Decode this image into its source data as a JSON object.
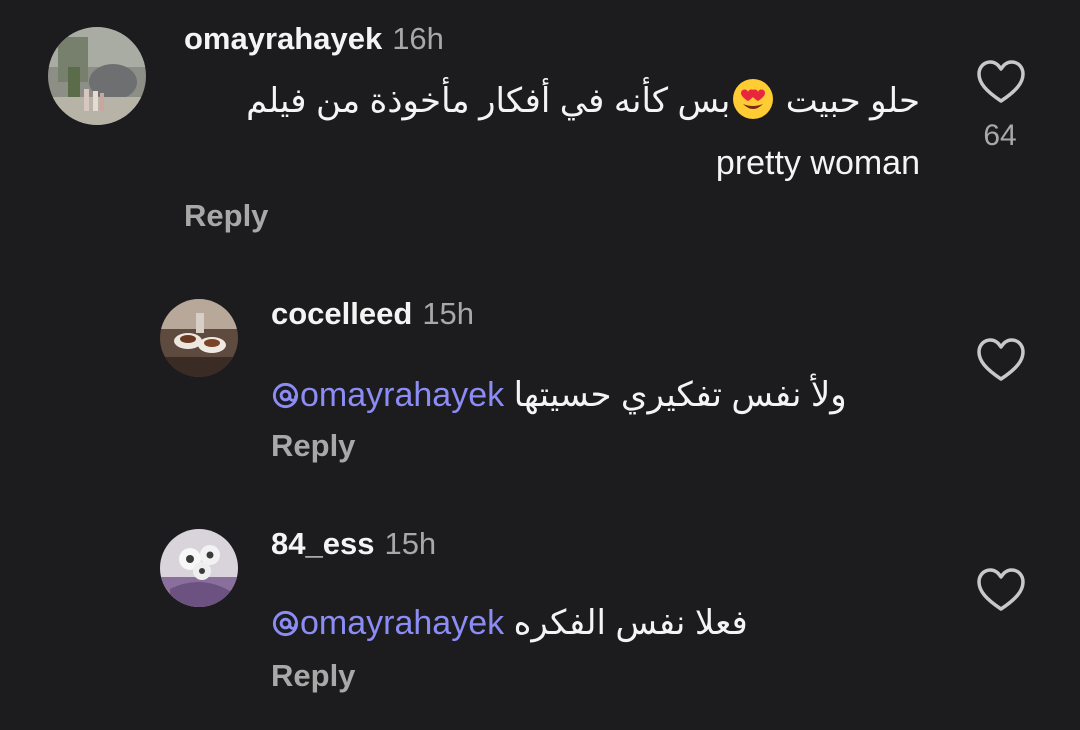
{
  "comments": [
    {
      "username": "omayrahayek",
      "time": "16h",
      "text_line1_after_emoji": "بس كأنه في أفكار مأخوذة  من فيلم",
      "text_line1_before_emoji": "حلو  حبيت",
      "emoji": "heart-eyes-emoji",
      "text_line2": "pretty woman",
      "reply_label": "Reply",
      "like_count": "64"
    },
    {
      "username": "cocelleed",
      "time": "15h",
      "mention": "@omayrahayek",
      "text": "ولأ نفس تفكيري حسيتها",
      "reply_label": "Reply"
    },
    {
      "username": "84_ess",
      "time": "15h",
      "mention": "@omayrahayek",
      "text": "فعلا نفس الفكره",
      "reply_label": "Reply"
    }
  ],
  "colors": {
    "background": "#1c1c1e",
    "mention": "#8b8cf4",
    "secondary_text": "#a8a8a8",
    "primary_text": "#f4f4f4"
  },
  "icons": {
    "like": "heart-outline-icon",
    "mention_prefix": "threads-at-icon"
  }
}
